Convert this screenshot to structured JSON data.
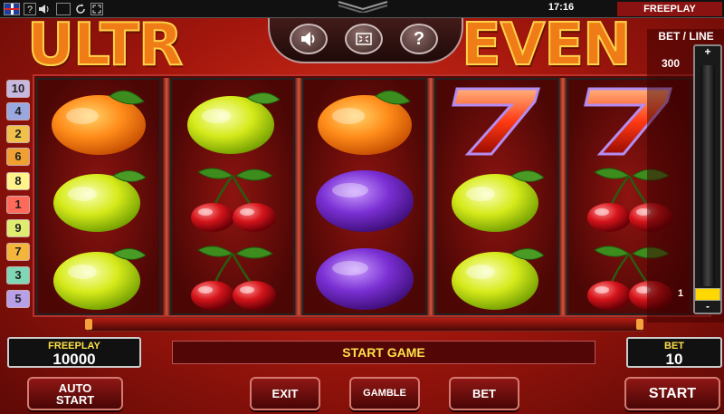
{
  "topbar": {
    "flag_icon": "uk-flag-icon",
    "help_icon": "question-icon",
    "sound_icon": "speaker-icon",
    "help_text": "?",
    "time": "17:16",
    "mode": "FREEPLAY"
  },
  "logo": {
    "left_text": "ULTR",
    "right_text": "EVEN"
  },
  "header_buttons": [
    {
      "icon": "speaker-icon",
      "glyph": "🔉"
    },
    {
      "icon": "fullscreen-icon",
      "glyph": "⛶"
    },
    {
      "icon": "help-icon",
      "glyph": "?"
    }
  ],
  "paylines_left": [
    "10",
    "4",
    "2",
    "6",
    "8",
    "1",
    "9",
    "7",
    "3",
    "5"
  ],
  "paylines_colors": {
    "10": "#c7b8df",
    "4": "#99a8e0",
    "2": "#f0c04a",
    "6": "#f0a030",
    "8": "#fff38a",
    "1": "#ff6a5a",
    "9": "#e0ec70",
    "7": "#f5b53a",
    "3": "#80d7b6",
    "5": "#b7a0e8"
  },
  "reels": [
    [
      "orange",
      "lemon",
      "lemon"
    ],
    [
      "lemon",
      "cherries",
      "cherries"
    ],
    [
      "orange",
      "plum",
      "plum"
    ],
    [
      "seven",
      "lemon",
      "lemon"
    ],
    [
      "seven",
      "cherries",
      "cherries"
    ]
  ],
  "bet_per_line": {
    "title": "BET / LINE",
    "max": "300",
    "min": "1",
    "plus": "+",
    "minus": "-",
    "level": 0
  },
  "freeplay_box": {
    "label": "FREEPLAY",
    "value": "10000"
  },
  "message": "START GAME",
  "bet_box": {
    "label": "BET",
    "value": "10"
  },
  "buttons": {
    "auto_start_line1": "AUTO",
    "auto_start_line2": "START",
    "exit": "EXIT",
    "gamble": "GAMBLE",
    "bet": "BET",
    "start": "START"
  },
  "colors": {
    "accent_yellow": "#ffe14a",
    "reel_bg": "#4c0705",
    "frame_red": "#b7322a"
  }
}
